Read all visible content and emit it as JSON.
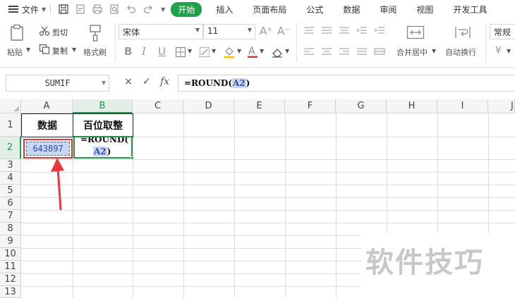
{
  "menu": {
    "file_label": "文件",
    "tabs": [
      "开始",
      "插入",
      "页面布局",
      "公式",
      "数据",
      "审阅",
      "视图",
      "开发工具"
    ],
    "active_tab": "开始"
  },
  "ribbon": {
    "paste": "粘贴",
    "cut": "剪切",
    "copy": "复制",
    "format_painter": "格式刷",
    "font_name": "宋体",
    "font_size": "11",
    "merge_center": "合并居中",
    "wrap_text": "自动换行",
    "number_format": "常规",
    "currency_symbol": "¥"
  },
  "formula_bar": {
    "name_box": "SUMIF",
    "cancel": "×",
    "enter": "✓",
    "fx": "fx",
    "formula_prefix": "=ROUND(",
    "formula_ref": "A2",
    "formula_suffix": ")"
  },
  "grid": {
    "columns": [
      "A",
      "B",
      "C",
      "D",
      "E",
      "F",
      "G",
      "H",
      "I",
      "J"
    ],
    "rows": [
      "1",
      "2",
      "3",
      "4",
      "5",
      "6",
      "7",
      "8",
      "9",
      "10",
      "11",
      "12",
      "13"
    ],
    "cells": {
      "A1": "数据",
      "B1": "百位取整",
      "A2": "643897",
      "B2_line1": "=ROUND(",
      "B2_ref": "A2",
      "B2_suffix": ")"
    },
    "selected_column": "B",
    "selected_row": "2"
  },
  "watermark": "软件技巧",
  "colors": {
    "accent_green": "#1fa34a",
    "highlight_red": "#d9363e",
    "reference_blue": "#c9d6f4"
  }
}
